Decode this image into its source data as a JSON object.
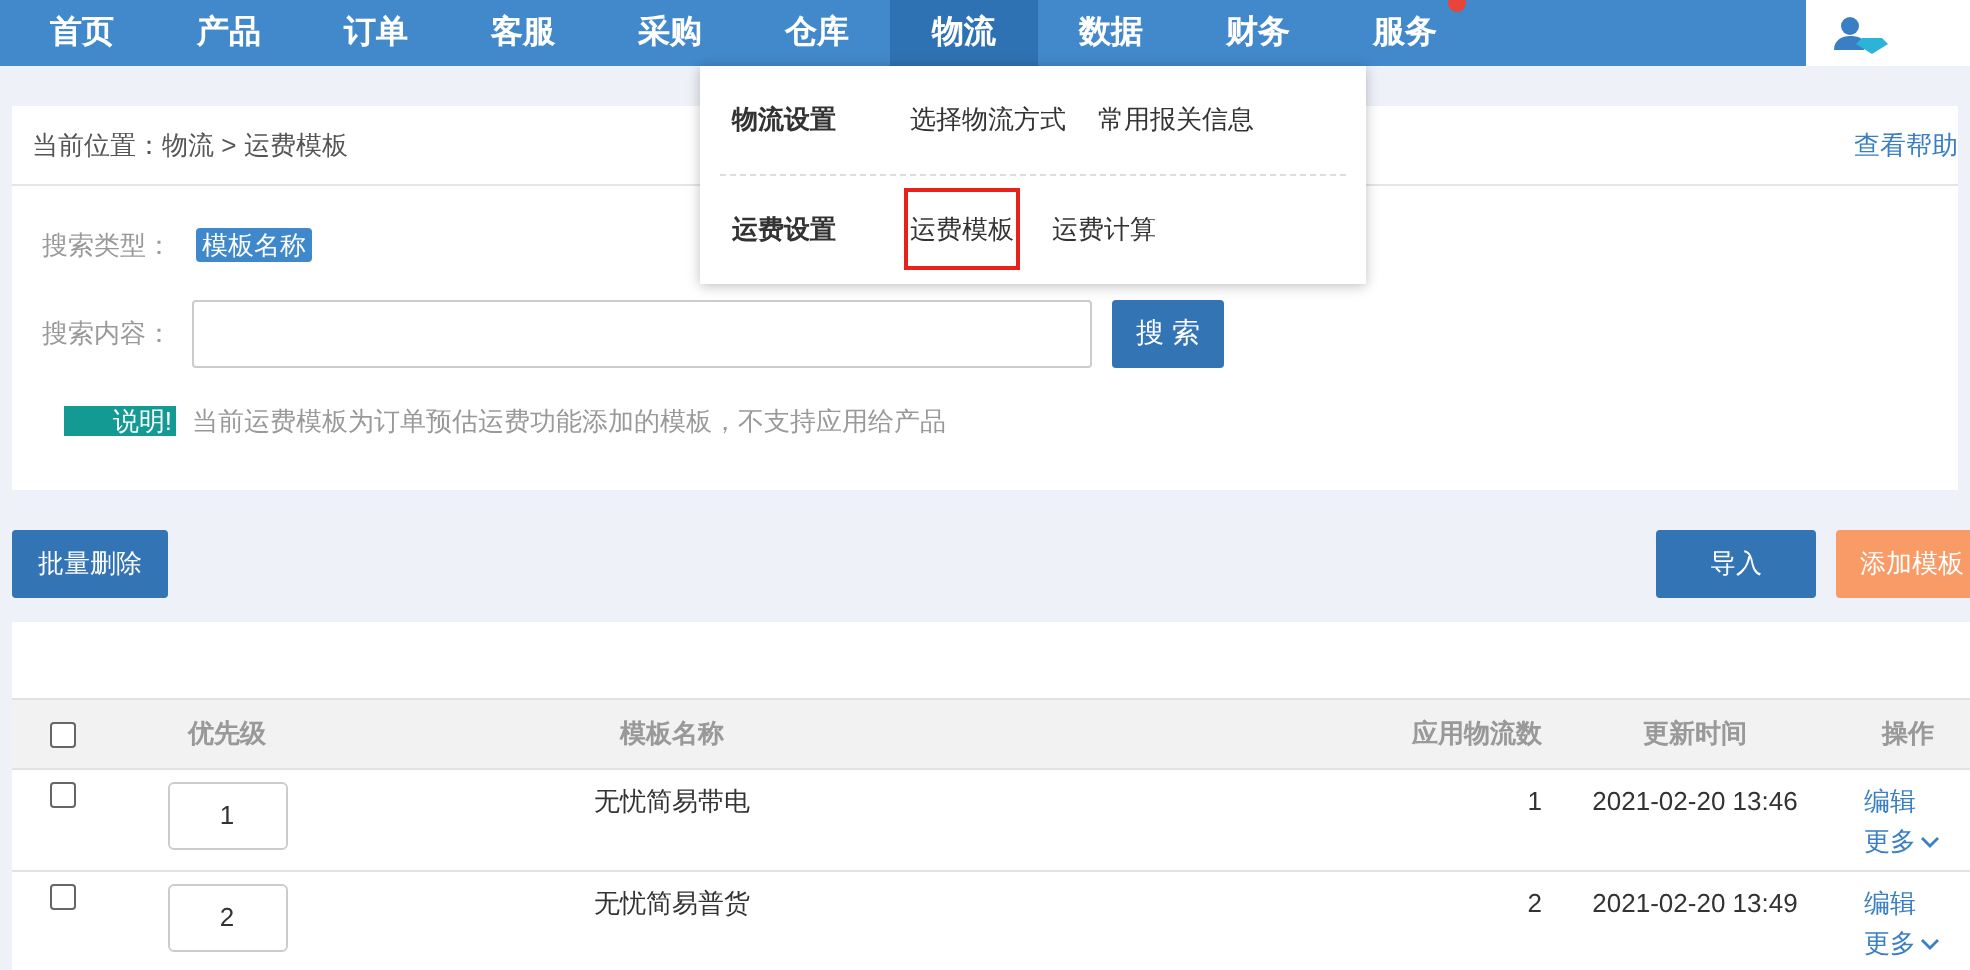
{
  "nav": {
    "items": [
      {
        "label": "首页",
        "selected": false,
        "badge": false
      },
      {
        "label": "产品",
        "selected": false,
        "badge": false
      },
      {
        "label": "订单",
        "selected": false,
        "badge": false
      },
      {
        "label": "客服",
        "selected": false,
        "badge": false
      },
      {
        "label": "采购",
        "selected": false,
        "badge": false
      },
      {
        "label": "仓库",
        "selected": false,
        "badge": false
      },
      {
        "label": "物流",
        "selected": true,
        "badge": false
      },
      {
        "label": "数据",
        "selected": false,
        "badge": false
      },
      {
        "label": "财务",
        "selected": false,
        "badge": false
      },
      {
        "label": "服务",
        "selected": false,
        "badge": true
      }
    ]
  },
  "dropdown": {
    "groups": [
      {
        "title": "物流设置",
        "items": [
          {
            "label": "选择物流方式",
            "highlighted": false
          },
          {
            "label": "常用报关信息",
            "highlighted": false
          }
        ]
      },
      {
        "title": "运费设置",
        "items": [
          {
            "label": "运费模板",
            "highlighted": true
          },
          {
            "label": "运费计算",
            "highlighted": false
          }
        ]
      }
    ]
  },
  "breadcrumb": "当前位置：物流 > 运费模板",
  "help_link": "查看帮助",
  "search": {
    "type_label": "搜索类型：",
    "type_tag": "模板名称",
    "content_label": "搜索内容：",
    "button": "搜 索"
  },
  "notice": {
    "tag": "说明!",
    "text": "当前运费模板为订单预估运费功能添加的模板，不支持应用给产品"
  },
  "actions": {
    "batch_delete": "批量删除",
    "import": "导入",
    "add": "添加模板"
  },
  "table": {
    "select_all_checked": false,
    "columns": [
      "优先级",
      "模板名称",
      "应用物流数",
      "更新时间",
      "操作"
    ],
    "rows": [
      {
        "checked": false,
        "priority": "1",
        "name": "无忧简易带电",
        "count": "1",
        "updated": "2021-02-20 13:46",
        "edit": "编辑",
        "more": "更多"
      },
      {
        "checked": false,
        "priority": "2",
        "name": "无忧简易普货",
        "count": "2",
        "updated": "2021-02-20 13:49",
        "edit": "编辑",
        "more": "更多"
      }
    ]
  }
}
